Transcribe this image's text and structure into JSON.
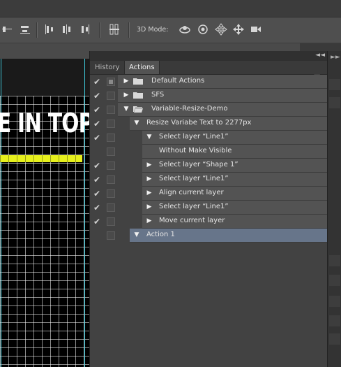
{
  "options_bar": {
    "three_d_mode_label": "3D Mode:"
  },
  "panel": {
    "tabs": [
      {
        "label": "History",
        "active": false
      },
      {
        "label": "Actions",
        "active": true
      }
    ],
    "actions": [
      {
        "label": "Default Actions",
        "level": 0,
        "kind": "set",
        "expanded": false,
        "checked": true,
        "dialog": true
      },
      {
        "label": "SFS",
        "level": 0,
        "kind": "set",
        "expanded": false,
        "checked": true,
        "dialog": false
      },
      {
        "label": "Variable-Resize-Demo",
        "level": 0,
        "kind": "set",
        "expanded": true,
        "checked": true,
        "dialog": false
      },
      {
        "label": "Resize Variabe Text to 2277px",
        "level": 1,
        "kind": "action",
        "expanded": true,
        "checked": true,
        "dialog": false
      },
      {
        "label": "Select layer “Line1”",
        "level": 2,
        "kind": "step",
        "expanded": true,
        "checked": true,
        "dialog": false
      },
      {
        "label": "Without Make Visible",
        "level": 3,
        "kind": "detail",
        "expanded": false,
        "checked": false,
        "dialog": false
      },
      {
        "label": "Select layer “Shape 1”",
        "level": 2,
        "kind": "step",
        "expanded": false,
        "checked": true,
        "dialog": false
      },
      {
        "label": "Select layer “Line1”",
        "level": 2,
        "kind": "step",
        "expanded": false,
        "checked": true,
        "dialog": false
      },
      {
        "label": "Align current layer",
        "level": 2,
        "kind": "step",
        "expanded": false,
        "checked": true,
        "dialog": false
      },
      {
        "label": "Select layer “Line1”",
        "level": 2,
        "kind": "step",
        "expanded": false,
        "checked": true,
        "dialog": false
      },
      {
        "label": "Move current layer",
        "level": 2,
        "kind": "step",
        "expanded": false,
        "checked": true,
        "dialog": false
      },
      {
        "label": "Action 1",
        "level": 1,
        "kind": "action",
        "expanded": true,
        "checked": false,
        "dialog": false,
        "selected": true
      }
    ]
  },
  "canvas": {
    "visible_text": "E IN TOP",
    "highlight_color": "#e6ef1d",
    "guide_color": "#3ec6d6"
  },
  "colors": {
    "panel_bg": "#424242",
    "row_bg": "#535353",
    "selected_row_bg": "#67758a"
  }
}
